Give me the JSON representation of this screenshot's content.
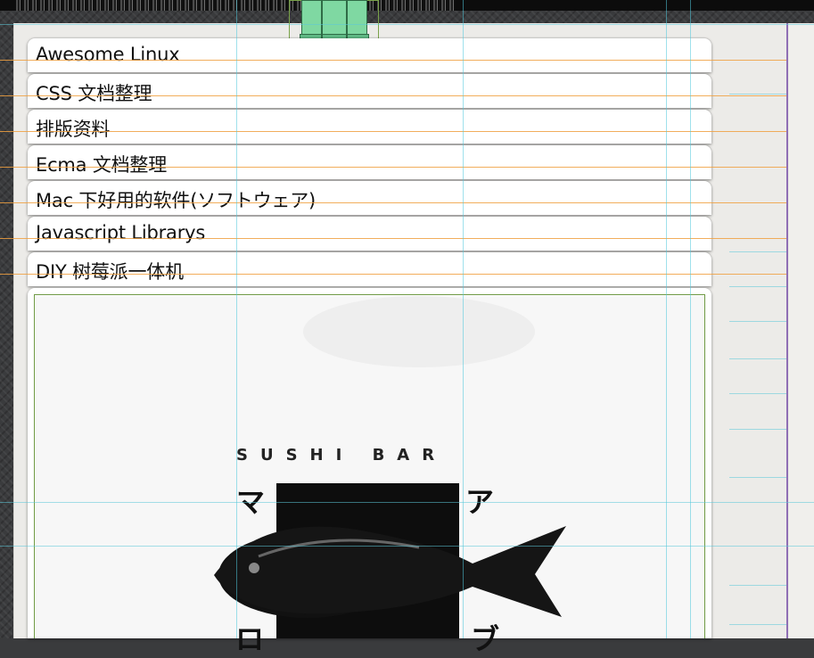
{
  "nav": {
    "items": [
      {
        "label": "Awesome Linux"
      },
      {
        "label": "CSS 文档整理"
      },
      {
        "label": "排版资料"
      },
      {
        "label": "Ecma 文档整理"
      },
      {
        "label": "Mac 下好用的软件(ソフトウェア)"
      },
      {
        "label": "Javascript Librarys"
      },
      {
        "label": "DIY 树莓派一体机"
      }
    ]
  },
  "poster": {
    "bar_text": "SUSHI BAR",
    "kana_left": "マ",
    "kana_right": "ア",
    "kana_bottom_left": "ロ",
    "kana_bottom_right": "ブ"
  },
  "colors": {
    "guide_orange": "#f0a040",
    "guide_cyan": "#5cc8d8",
    "frame_green": "#6f9a44",
    "clip_green": "#7fd8a2"
  }
}
